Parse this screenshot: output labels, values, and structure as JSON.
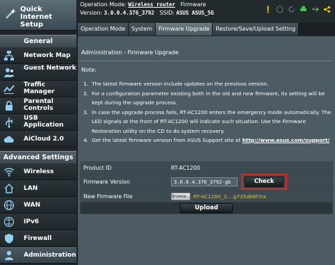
{
  "sidebar": {
    "quick_setup": "Quick Internet Setup",
    "general_header": "General",
    "general_items": [
      {
        "label": "Network Map",
        "icon": "network-map-icon"
      },
      {
        "label": "Guest Network",
        "icon": "guest-network-icon"
      },
      {
        "label": "Traffic Manager",
        "icon": "traffic-manager-icon"
      },
      {
        "label": "Parental Controls",
        "icon": "parental-controls-icon"
      },
      {
        "label": "USB Application",
        "icon": "usb-icon"
      },
      {
        "label": "AiCloud 2.0",
        "icon": "cloud-icon"
      }
    ],
    "advanced_header": "Advanced Settings",
    "advanced_items": [
      {
        "label": "Wireless",
        "icon": "wireless-icon"
      },
      {
        "label": "LAN",
        "icon": "lan-icon"
      },
      {
        "label": "WAN",
        "icon": "wan-icon"
      },
      {
        "label": "IPv6",
        "icon": "ipv6-icon"
      },
      {
        "label": "Firewall",
        "icon": "firewall-icon"
      },
      {
        "label": "Administration",
        "icon": "administration-icon",
        "active": true
      }
    ]
  },
  "header": {
    "op_mode_label": "Operation Mode:",
    "op_mode_value": "Wireless router",
    "firmware_label": "Firmware",
    "version_label": "Version:",
    "version_value": "3.0.0.4.376_3792",
    "ssid_label": "SSID:",
    "ssid_value": "ASUS ASUS_5G"
  },
  "tabs": [
    "Operation Mode",
    "System",
    "Firmware Upgrade",
    "Restore/Save/Upload Setting"
  ],
  "active_tab": "Firmware Upgrade",
  "main": {
    "page_title": "Administration - Firmware Upgrade",
    "note_title": "Note:",
    "notes": [
      {
        "num": "1.",
        "text": "The latest firmware version include updates on the previous version."
      },
      {
        "num": "2.",
        "text": "For a configuration parameter existing both in the old and new firmware, its setting will be kept during the upgrade process."
      },
      {
        "num": "3.",
        "text": "In case the upgrade process fails, RT-AC1200 enters the emergency mode automatically. The LED signals at the front of RT-AC1200 will indicate such situation. Use the Firmware Restoration utility on the CD to do system recovery."
      },
      {
        "num": "4.",
        "text": "Get the latest firmware version from ASUS Support site at",
        "link": "http://www.asus.com/support/"
      }
    ],
    "product_id_label": "Product ID",
    "product_id_value": "RT-AC1200",
    "firmware_version_label": "Firmware Version",
    "firmware_version_value": "3.0.0.4.376_3792-gb",
    "check_button": "Check",
    "new_firmware_label": "New Firmware File",
    "browse_button": "Browse...",
    "file_name": "RT-AC1200_3....g735db6f.trx",
    "upload_button": "Upload"
  },
  "colors": {
    "highlight_border": "#e0281f",
    "file_name": "#f2c700"
  }
}
